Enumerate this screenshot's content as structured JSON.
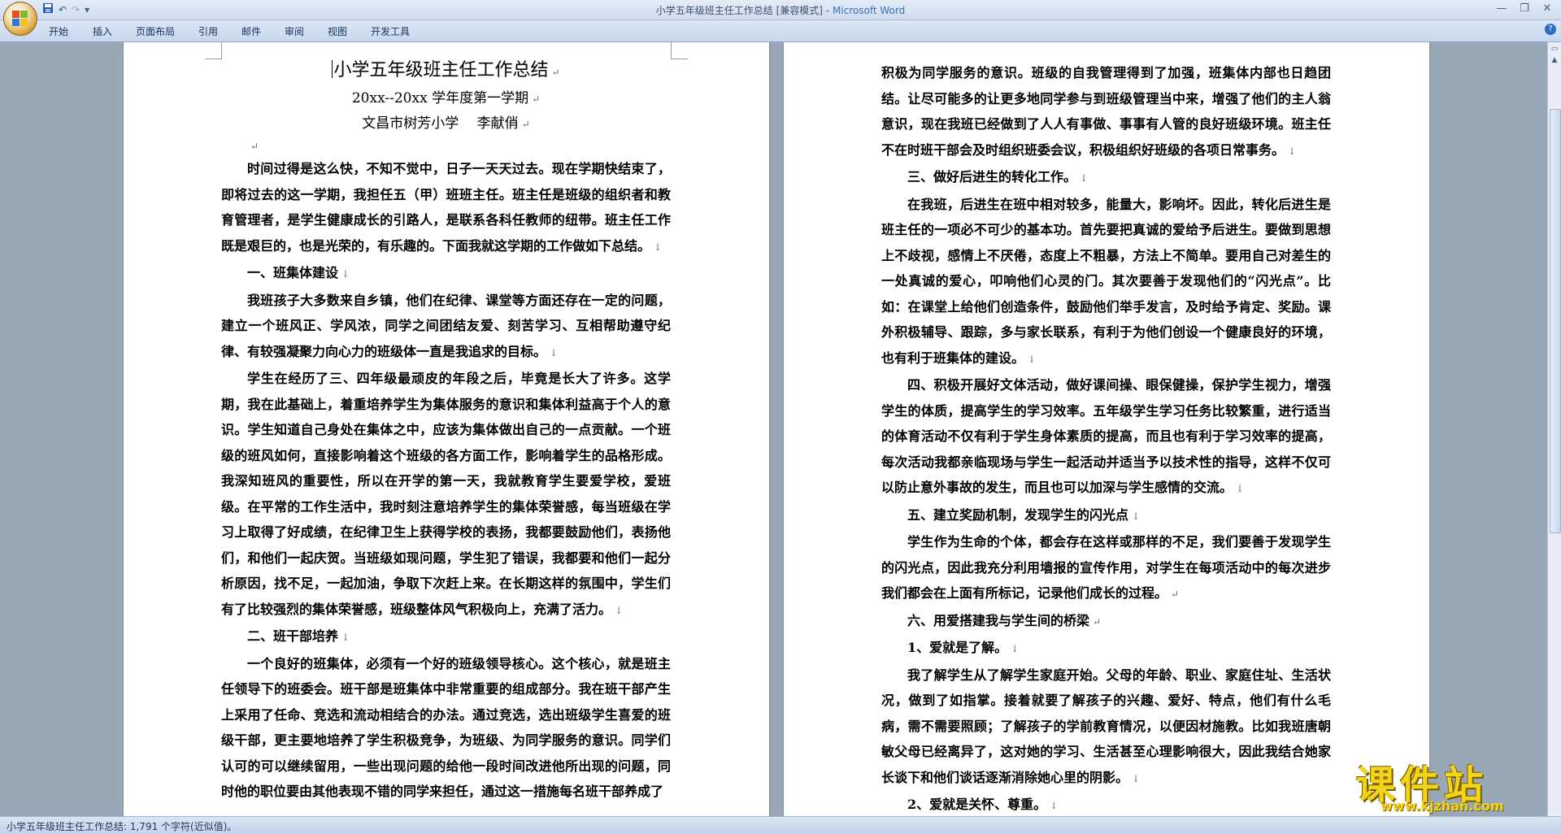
{
  "window": {
    "title": "小学五年级班主任工作总结 [兼容模式]",
    "separator": " - ",
    "app_name": "Microsoft Word"
  },
  "quick_access": {
    "save_icon": "save-icon",
    "undo_glyph": "↶",
    "redo_glyph": "↷",
    "more_glyph": "▾"
  },
  "window_buttons": {
    "minimize": "—",
    "maximize": "❐",
    "close": "✕"
  },
  "ribbon": {
    "tabs": [
      "开始",
      "插入",
      "页面布局",
      "引用",
      "邮件",
      "审阅",
      "视图",
      "开发工具"
    ],
    "help": "?"
  },
  "document": {
    "title": "小学五年级班主任工作总结",
    "term": "20xx--20xx 学年度第一学期",
    "author": "文昌市树芳小学　 李献俏",
    "left_paragraphs": [
      "时间过得是这么快，不知不觉中，日子一天天过去。现在学期快结束了，即将过去的这一学期，我担任五（甲）班班主任。班主任是班级的组织者和教育管理者，是学生健康成长的引路人，是联系各科任教师的纽带。班主任工作既是艰巨的，也是光荣的，有乐趣的。下面我就这学期的工作做如下总结。",
      "一、班集体建设",
      "我班孩子大多数来自乡镇，他们在纪律、课堂等方面还存在一定的问题，建立一个班风正、学风浓，同学之间团结友爱、刻苦学习、互相帮助遵守纪律、有较强凝聚力向心力的班级体一直是我追求的目标。",
      "学生在经历了三、四年级最顽皮的年段之后，毕竟是长大了许多。这学期，我在此基础上，着重培养学生为集体服务的意识和集体利益高于个人的意识。学生知道自己身处在集体之中，应该为集体做出自己的一点贡献。一个班级的班风如何，直接影响着这个班级的各方面工作，影响着学生的品格形成。我深知班风的重要性，所以在开学的第一天，我就教育学生要爱学校，爱班级。在平常的工作生活中，我时刻注意培养学生的集体荣誉感，每当班级在学习上取得了好成绩，在纪律卫生上获得学校的表扬，我都要鼓励他们，表扬他们，和他们一起庆贺。当班级如现问题，学生犯了错误，我都要和他们一起分析原因，找不足，一起加油，争取下次赶上来。在长期这样的氛围中，学生们有了比较强烈的集体荣誉感，班级整体风气积极向上，充满了活力。",
      "二、班干部培养",
      "一个良好的班集体，必须有一个好的班级领导核心。这个核心，就是班主任领导下的班委会。班干部是班集体中非常重要的组成部分。我在班干部产生上采用了任命、竞选和流动相结合的办法。通过竞选，选出班级学生喜爱的班级干部，更主要地培养了学生积极竞争，为班级、为同学服务的意识。同学们认可的可以继续留用，一些出现问题的给他一段时间改进他所出现的问题，同时他的职位要由其他表现不错的同学来担任，通过这一措施每名班干部养成了"
    ],
    "right_paragraphs": [
      "积极为同学服务的意识。班级的自我管理得到了加强，班集体内部也日趋团结。让尽可能多的让更多地同学参与到班级管理当中来，增强了他们的主人翁意识，现在我班已经做到了人人有事做、事事有人管的良好班级环境。班主任不在时班干部会及时组织班委会议，积极组织好班级的各项日常事务。",
      "三、做好后进生的转化工作。",
      "在我班，后进生在班中相对较多，能量大，影响坏。因此，转化后进生是班主任的一项必不可少的基本功。首先要把真诚的爱给予后进生。要做到思想上不歧视，感情上不厌倦，态度上不粗暴，方法上不简单。要用自己对差生的一处真诚的爱心，叩响他们心灵的门。其次要善于发现他们的“闪光点”。比如：在课堂上给他们创造条件，鼓励他们举手发言，及时给予肯定、奖励。课外积极辅导、跟踪，多与家长联系，有利于为他们创设一个健康良好的环境，也有利于班集体的建设。",
      "四、积极开展好文体活动，做好课间操、眼保健操，保护学生视力，增强学生的体质，提高学生的学习效率。五年级学生学习任务比较繁重，进行适当的体育活动不仅有利于学生身体素质的提高，而且也有利于学习效率的提高，每次活动我都亲临现场与学生一起活动并适当予以技术性的指导，这样不仅可以防止意外事故的发生，而且也可以加深与学生感情的交流。",
      "五、建立奖励机制，发现学生的闪光点",
      "学生作为生命的个体，都会存在这样或那样的不足，我们要善于发现学生的闪光点，因此我充分利用墙报的宣传作用，对学生在每项活动中的每次进步我们都会在上面有所标记，记录他们成长的过程。",
      "六、用爱搭建我与学生间的桥梁",
      "1、爱就是了解。",
      "我了解学生从了解学生家庭开始。父母的年龄、职业、家庭住址、生活状况，做到了如指掌。接着就要了解孩子的兴趣、爱好、特点，他们有什么毛病，需不需要照顾；了解孩子的学前教育情况，以便因材施教。比如我班唐朝敏父母已经离异了，这对她的学习、生活甚至心理影响很大，因此我结合她家长谈下和他们谈话逐渐消除她心里的阴影。",
      "2、爱就是关怀、尊重。"
    ],
    "pilcrow": "↵",
    "line_break": "↓"
  },
  "status_bar": {
    "text": "小学五年级班主任工作总结: 1,791 个字符(近似值)。"
  },
  "watermark": {
    "brand": "课件站",
    "url": "www.kjzhan.com"
  }
}
